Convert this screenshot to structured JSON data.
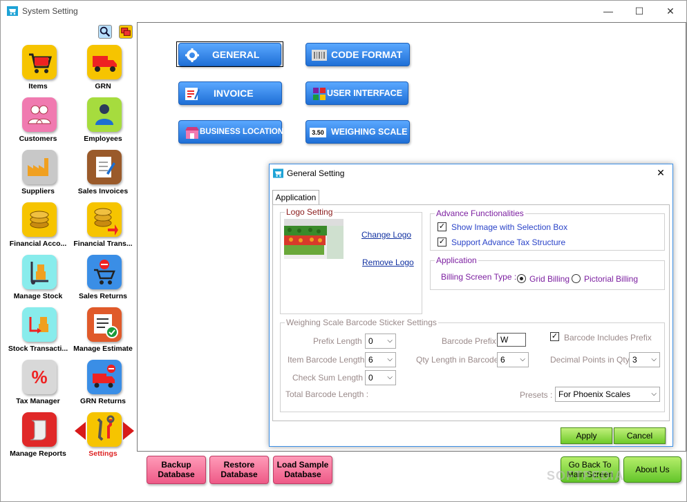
{
  "window": {
    "title": "System Setting",
    "minimize": "—",
    "maximize": "☐",
    "close": "✕"
  },
  "toolbar": {
    "search_icon": "magnifier",
    "layers_icon": "windows"
  },
  "sidebar": {
    "items": [
      {
        "label": "Items",
        "icon": "cart",
        "color": "#f6c400"
      },
      {
        "label": "GRN",
        "icon": "truck",
        "color": "#f6c400"
      },
      {
        "label": "Customers",
        "icon": "people",
        "color": "#f07ab0"
      },
      {
        "label": "Employees",
        "icon": "person",
        "color": "#a6dc3e"
      },
      {
        "label": "Suppliers",
        "icon": "factory",
        "color": "#b0b0b0"
      },
      {
        "label": "Sales Invoices",
        "icon": "document-pen",
        "color": "#9a5a2a"
      },
      {
        "label": "Financial Acco...",
        "icon": "coins",
        "color": "#f6c400"
      },
      {
        "label": "Financial Trans...",
        "icon": "coins-arrow",
        "color": "#f6c400"
      },
      {
        "label": "Manage Stock",
        "icon": "hand-truck",
        "color": "#66e0e0"
      },
      {
        "label": "Sales Returns",
        "icon": "cart-return",
        "color": "#3a8ee6"
      },
      {
        "label": "Stock Transacti...",
        "icon": "stock-arrow",
        "color": "#66e0e0"
      },
      {
        "label": "Manage Estimate",
        "icon": "estimate-check",
        "color": "#e05a2a"
      },
      {
        "label": "Tax Manager",
        "icon": "percent",
        "color": "#d0d0d0"
      },
      {
        "label": "GRN Returns",
        "icon": "truck-return",
        "color": "#3a8ee6"
      },
      {
        "label": "Manage Reports",
        "icon": "report-scroll",
        "color": "#e02828"
      },
      {
        "label": "Settings",
        "icon": "tools",
        "color": "#f6c400"
      }
    ]
  },
  "main": {
    "buttons": {
      "general": "GENERAL",
      "code_format": "CODE FORMAT",
      "invoice": "INVOICE",
      "user_interface": "USER INTERFACE",
      "business_location": "BUSINESS LOCATION",
      "weighing_scale": "WEIGHING SCALE",
      "weighing_scale_badge": "3.50"
    }
  },
  "dialog": {
    "title": "General Setting",
    "tab": "Application",
    "logo_setting": {
      "label": "Logo Setting",
      "change": "Change Logo",
      "remove": "Remove Logo"
    },
    "advance": {
      "label": "Advance Functionalities",
      "show_image": "Show Image with Selection Box",
      "support_tax": "Support Advance Tax Structure",
      "show_image_checked": true,
      "support_tax_checked": true
    },
    "application": {
      "label": "Application",
      "billing_label": "Billing Screen Type :",
      "grid": "Grid Billing",
      "pictorial": "Pictorial Billing",
      "selected": "Grid Billing"
    },
    "weighing": {
      "label": "Weighing Scale Barcode Sticker Settings",
      "prefix_length_label": "Prefix Length :",
      "prefix_length": "0",
      "item_barcode_length_label": "Item Barcode Length :",
      "item_barcode_length": "6",
      "check_sum_length_label": "Check Sum Length :",
      "check_sum_length": "0",
      "total_barcode_length_label": "Total Barcode Length :",
      "barcode_prefix_label": "Barcode Prefix :",
      "barcode_prefix": "W",
      "qty_length_label": "Qty Length in Barcode :",
      "qty_length": "6",
      "includes_prefix": "Barcode Includes Prefix",
      "includes_prefix_checked": true,
      "decimal_points_label": "Decimal Points in Qty :",
      "decimal_points": "3",
      "presets_label": "Presets :",
      "presets": "For Phoenix Scales"
    },
    "apply": "Apply",
    "cancel": "Cancel"
  },
  "footer": {
    "backup": "Backup Database",
    "restore": "Restore Database",
    "load_sample": "Load Sample Database",
    "go_back": "Go Back To Main Screen",
    "about": "About Us"
  },
  "watermark": "SOFTPEDIA"
}
